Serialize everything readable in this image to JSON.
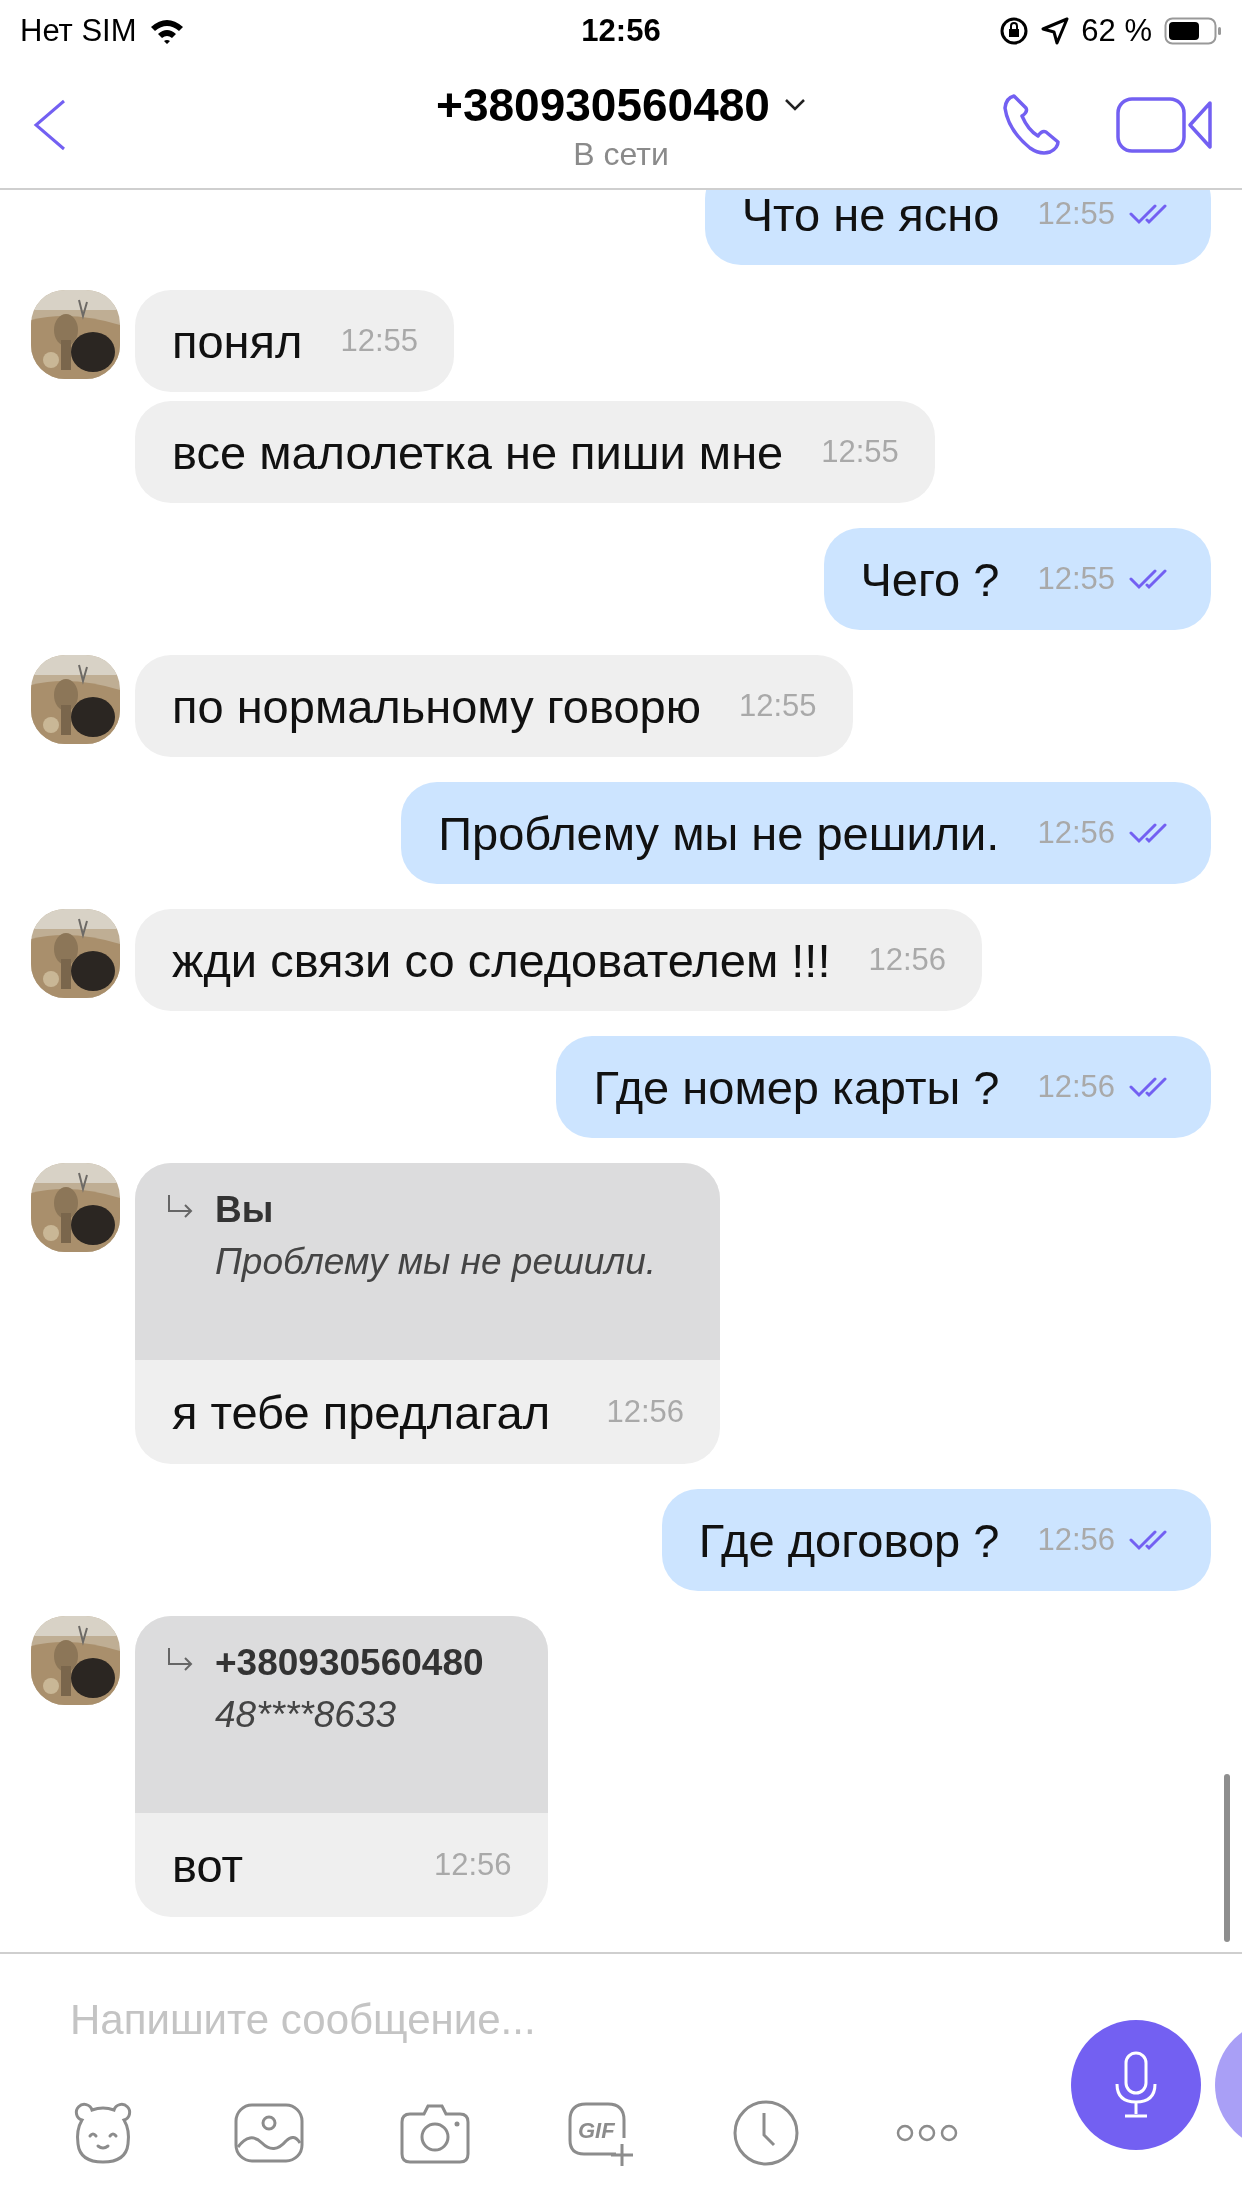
{
  "status_bar": {
    "carrier": "Нет SIM",
    "time": "12:56",
    "battery": "62 %"
  },
  "header": {
    "contact": "+380930560480",
    "status": "В сети"
  },
  "messages": [
    {
      "kind": "outgoing",
      "text": "Что не ясно",
      "time": "12:55",
      "read": true
    },
    {
      "kind": "incoming",
      "text": "понял",
      "time": "12:55",
      "avatar": true
    },
    {
      "kind": "incoming",
      "text": "все малолетка не пиши мне",
      "time": "12:55",
      "avatar": false
    },
    {
      "kind": "outgoing",
      "text": "Чего ?",
      "time": "12:55",
      "read": true
    },
    {
      "kind": "incoming",
      "text": "по нормальному говорю",
      "time": "12:55",
      "avatar": true
    },
    {
      "kind": "outgoing",
      "text": "Проблему мы не решили.",
      "time": "12:56",
      "read": true
    },
    {
      "kind": "incoming",
      "text": "жди связи со следователем !!!",
      "time": "12:56",
      "avatar": true
    },
    {
      "kind": "outgoing",
      "text": "Где номер карты ?",
      "time": "12:56",
      "read": true
    },
    {
      "kind": "reply",
      "avatar": true,
      "quote": {
        "author": "Вы",
        "text": "Проблему мы не решили."
      },
      "text": "я тебе предлагал",
      "time": "12:56"
    },
    {
      "kind": "outgoing",
      "text": "Где договор ?",
      "time": "12:56",
      "read": true
    },
    {
      "kind": "reply",
      "avatar": true,
      "quote": {
        "author": "+380930560480",
        "text": "48****8633"
      },
      "text": "вот",
      "time": "12:56"
    }
  ],
  "composer": {
    "placeholder": "Напишите сообщение...",
    "gif_label": "GIF"
  }
}
